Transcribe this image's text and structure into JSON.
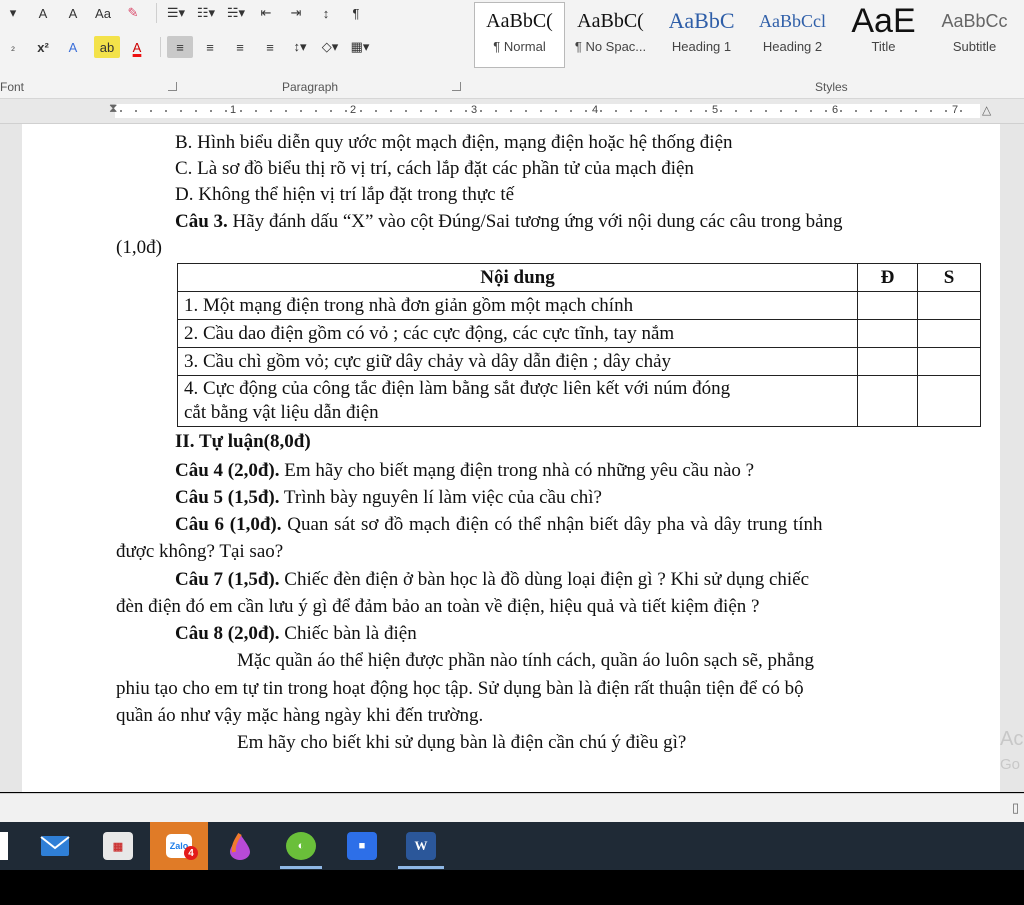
{
  "ribbon": {
    "font_row1": [
      "A",
      "A",
      "Aa"
    ],
    "font_row2": [
      "x²",
      "A",
      "ab",
      "A"
    ],
    "groups": {
      "font": "Font",
      "paragraph": "Paragraph",
      "styles": "Styles"
    },
    "styles": [
      {
        "sample": "AaBbC(",
        "name": "¶ Normal"
      },
      {
        "sample": "AaBbC(",
        "name": "¶ No Spac..."
      },
      {
        "sample": "AaBbC",
        "name": "Heading 1"
      },
      {
        "sample": "AaBbCcl",
        "name": "Heading 2"
      },
      {
        "sample": "AaE",
        "name": "Title"
      },
      {
        "sample": "AaBbCc",
        "name": "Subtitle"
      }
    ]
  },
  "ruler": {
    "numbers": [
      "1",
      "2",
      "3",
      "4",
      "5",
      "6",
      "7"
    ]
  },
  "document": {
    "lines": [
      "B. Hình biểu diễn quy ước một mạch điện, mạng điện hoặc hệ thống điện",
      "C. Là sơ đồ biểu thị rõ vị trí, cách lắp đặt các phần tử của mạch điện",
      "D. Không thể hiện vị trí lắp đặt trong thực tế"
    ],
    "q3_label": "Câu 3.",
    "q3_text": " Hãy đánh dấu “X” vào cột Đúng/Sai tương ứng với nội dung các câu trong bảng",
    "q3_points": "(1,0đ)",
    "table": {
      "headers": [
        "Nội dung",
        "Đ",
        "S"
      ],
      "rows": [
        "1. Một mạng điện trong nhà đơn giản gồm một mạch chính",
        "2. Cầu dao điện gồm có vỏ ; các cực động, các cực tĩnh, tay nắm",
        "3. Cầu chì gồm vỏ; cực giữ dây chảy và dây dẫn điện ; dây chảy"
      ],
      "row4_line1": "4. Cực động của công tắc điện làm bằng sắt được liên kết với núm đóng",
      "row4_line2": "cắt bằng vật liệu dẫn điện"
    },
    "section2": "II. Tự luận(8,0đ)",
    "q4_label": "Câu 4 (2,0đ).",
    "q4_text": " Em hãy cho biết mạng điện trong nhà có những yêu cầu nào ?",
    "q5_label": "Câu 5 (1,5đ).",
    "q5_text": " Trình bày nguyên lí làm việc của cầu chì?",
    "q6_label": "Câu 6 (1,0đ).",
    "q6_text": " Quan sát sơ đồ mạch điện có thể nhận biết dây pha và dây trung tính",
    "q6_cont": "được không? Tại sao?",
    "q7_label": "Câu 7 (1,5đ).",
    "q7_text": " Chiếc đèn điện ở bàn học là đồ dùng loại điện gì ? Khi sử dụng chiếc",
    "q7_cont": "đèn điện đó em cần lưu ý gì để đảm bảo an toàn về điện, hiệu quả và tiết kiệm điện ?",
    "q8_label": "Câu 8 (2,0đ).",
    "q8_text": " Chiếc bàn là điện",
    "q8_p1": "Mặc quần áo thể hiện được phần nào tính cách, quần áo luôn sạch sẽ, phẳng",
    "q8_p2": "phiu tạo cho em tự tin trong hoạt động học tập. Sử dụng bàn là điện rất thuận tiện để có bộ",
    "q8_p3": "quần áo như vậy mặc hàng ngày khi đến trường.",
    "q8_p4": "Em hãy cho biết khi sử dụng bàn là điện cần chú ý điều gì?"
  },
  "watermark": {
    "line1": "Ac",
    "line2": "Go"
  },
  "taskbar": {
    "icons": [
      "mail-icon",
      "calculator-icon",
      "zalo-icon",
      "paint-icon",
      "greenshot-icon",
      "zoom-icon",
      "word-icon"
    ],
    "word_label": "W",
    "zalo_badge": "4"
  }
}
